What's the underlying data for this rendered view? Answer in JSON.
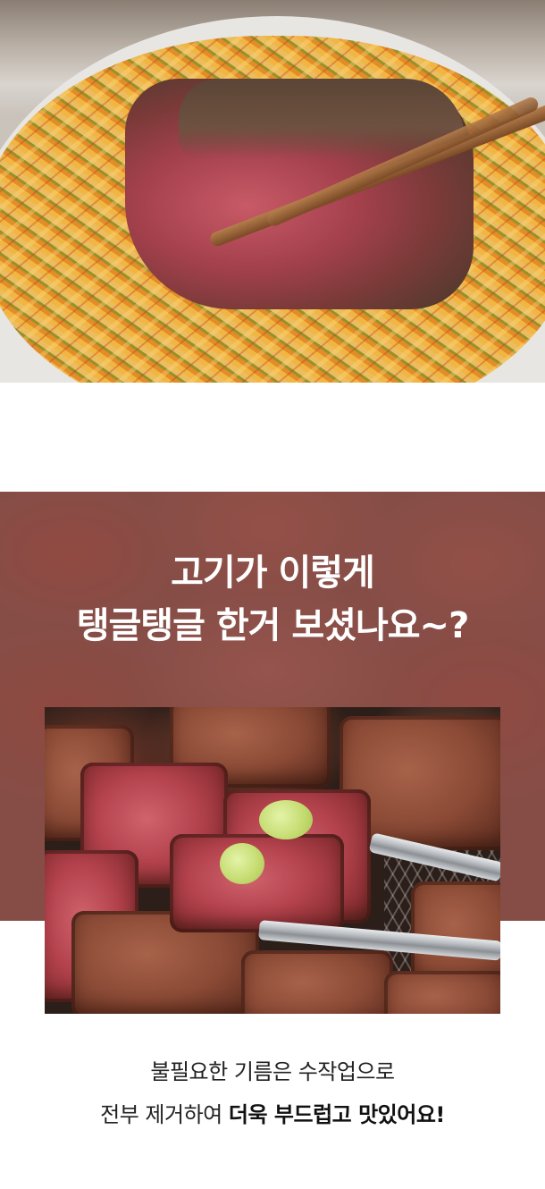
{
  "section_two": {
    "headline_line1": "고기가 이렇게",
    "headline_line2": "탱글탱글 한거 보셨나요~?"
  },
  "caption": {
    "line1": "불필요한 기름은 수작업으로",
    "line2_normal": "전부 제거하여 ",
    "line2_bold": "더욱 부드럽고 맛있어요!"
  },
  "colors": {
    "headline_text": "#ffffff",
    "caption_text": "#222222",
    "section_overlay": "#8e5750"
  }
}
